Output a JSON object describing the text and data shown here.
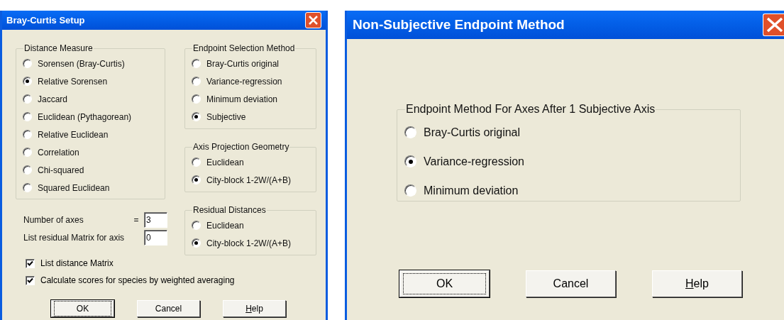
{
  "setup_dialog": {
    "title": "Bray-Curtis Setup",
    "distance_measure": {
      "legend": "Distance Measure",
      "options": [
        {
          "label": "Sorensen (Bray-Curtis)",
          "selected": false
        },
        {
          "label": "Relative Sorensen",
          "selected": true
        },
        {
          "label": "Jaccard",
          "selected": false
        },
        {
          "label": "Euclidean (Pythagorean)",
          "selected": false
        },
        {
          "label": "Relative Euclidean",
          "selected": false
        },
        {
          "label": "Correlation",
          "selected": false
        },
        {
          "label": "Chi-squared",
          "selected": false
        },
        {
          "label": "Squared Euclidean",
          "selected": false
        }
      ]
    },
    "side_groups": [
      {
        "legend": "Endpoint Selection Method",
        "options": [
          {
            "label": "Bray-Curtis original",
            "selected": false
          },
          {
            "label": "Variance-regression",
            "selected": false
          },
          {
            "label": "Minimum deviation",
            "selected": false
          },
          {
            "label": "Subjective",
            "selected": true
          }
        ]
      },
      {
        "legend": "Axis Projection Geometry",
        "options": [
          {
            "label": "Euclidean",
            "selected": false
          },
          {
            "label": "City-block 1-2W/(A+B)",
            "selected": true
          }
        ]
      },
      {
        "legend": "Residual Distances",
        "options": [
          {
            "label": "Euclidean",
            "selected": false
          },
          {
            "label": "City-block 1-2W/(A+B)",
            "selected": true
          }
        ]
      }
    ],
    "fields": [
      {
        "label": "Number of axes",
        "sign": "=",
        "value": "3"
      },
      {
        "label": "List residual Matrix for axis",
        "value": "0"
      }
    ],
    "checkboxes": [
      {
        "label": "List distance Matrix",
        "checked": true
      },
      {
        "label": "Calculate scores for species by weighted averaging",
        "checked": true
      }
    ],
    "buttons": [
      {
        "label": "OK",
        "focused": true,
        "mnemonic": false
      },
      {
        "label": "Cancel",
        "focused": false,
        "mnemonic": false
      },
      {
        "label": "Help",
        "focused": false,
        "mnemonic": true
      }
    ]
  },
  "endpoint_dialog": {
    "title": "Non-Subjective Endpoint Method",
    "group": {
      "legend": "Endpoint Method For Axes After 1 Subjective Axis",
      "options": [
        {
          "label": "Bray-Curtis original",
          "selected": false
        },
        {
          "label": "Variance-regression",
          "selected": true
        },
        {
          "label": "Minimum deviation",
          "selected": false
        }
      ]
    },
    "buttons": [
      {
        "label": "OK",
        "focused": true,
        "mnemonic": false
      },
      {
        "label": "Cancel",
        "focused": false,
        "mnemonic": false
      },
      {
        "label": "Help",
        "focused": false,
        "mnemonic": true
      }
    ]
  }
}
